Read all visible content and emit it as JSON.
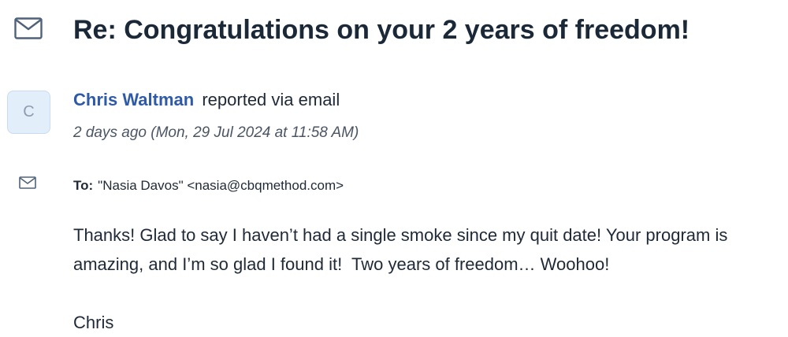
{
  "ticket": {
    "title": "Re: Congratulations on your 2 years of freedom!"
  },
  "sender": {
    "avatar_initial": "C",
    "name": "Chris Waltman",
    "action": "reported via email",
    "timestamp": "2 days ago (Mon, 29 Jul 2024 at 11:58 AM)"
  },
  "recipient": {
    "label": "To:",
    "value": "\"Nasia Davos\" <nasia@cbqmethod.com>"
  },
  "message": {
    "body": "Thanks! Glad to say I haven’t had a single smoke since my quit date! Your program is amazing, and I’m so glad I found it!  Two years of freedom… Woohoo!",
    "signature": "Chris"
  },
  "icons": {
    "title_icon": "envelope-icon",
    "recipient_icon": "envelope-icon"
  },
  "colors": {
    "sender_name": "#2f5aa8",
    "avatar_bg": "#e3eefb",
    "icon_stroke": "#50627a"
  }
}
